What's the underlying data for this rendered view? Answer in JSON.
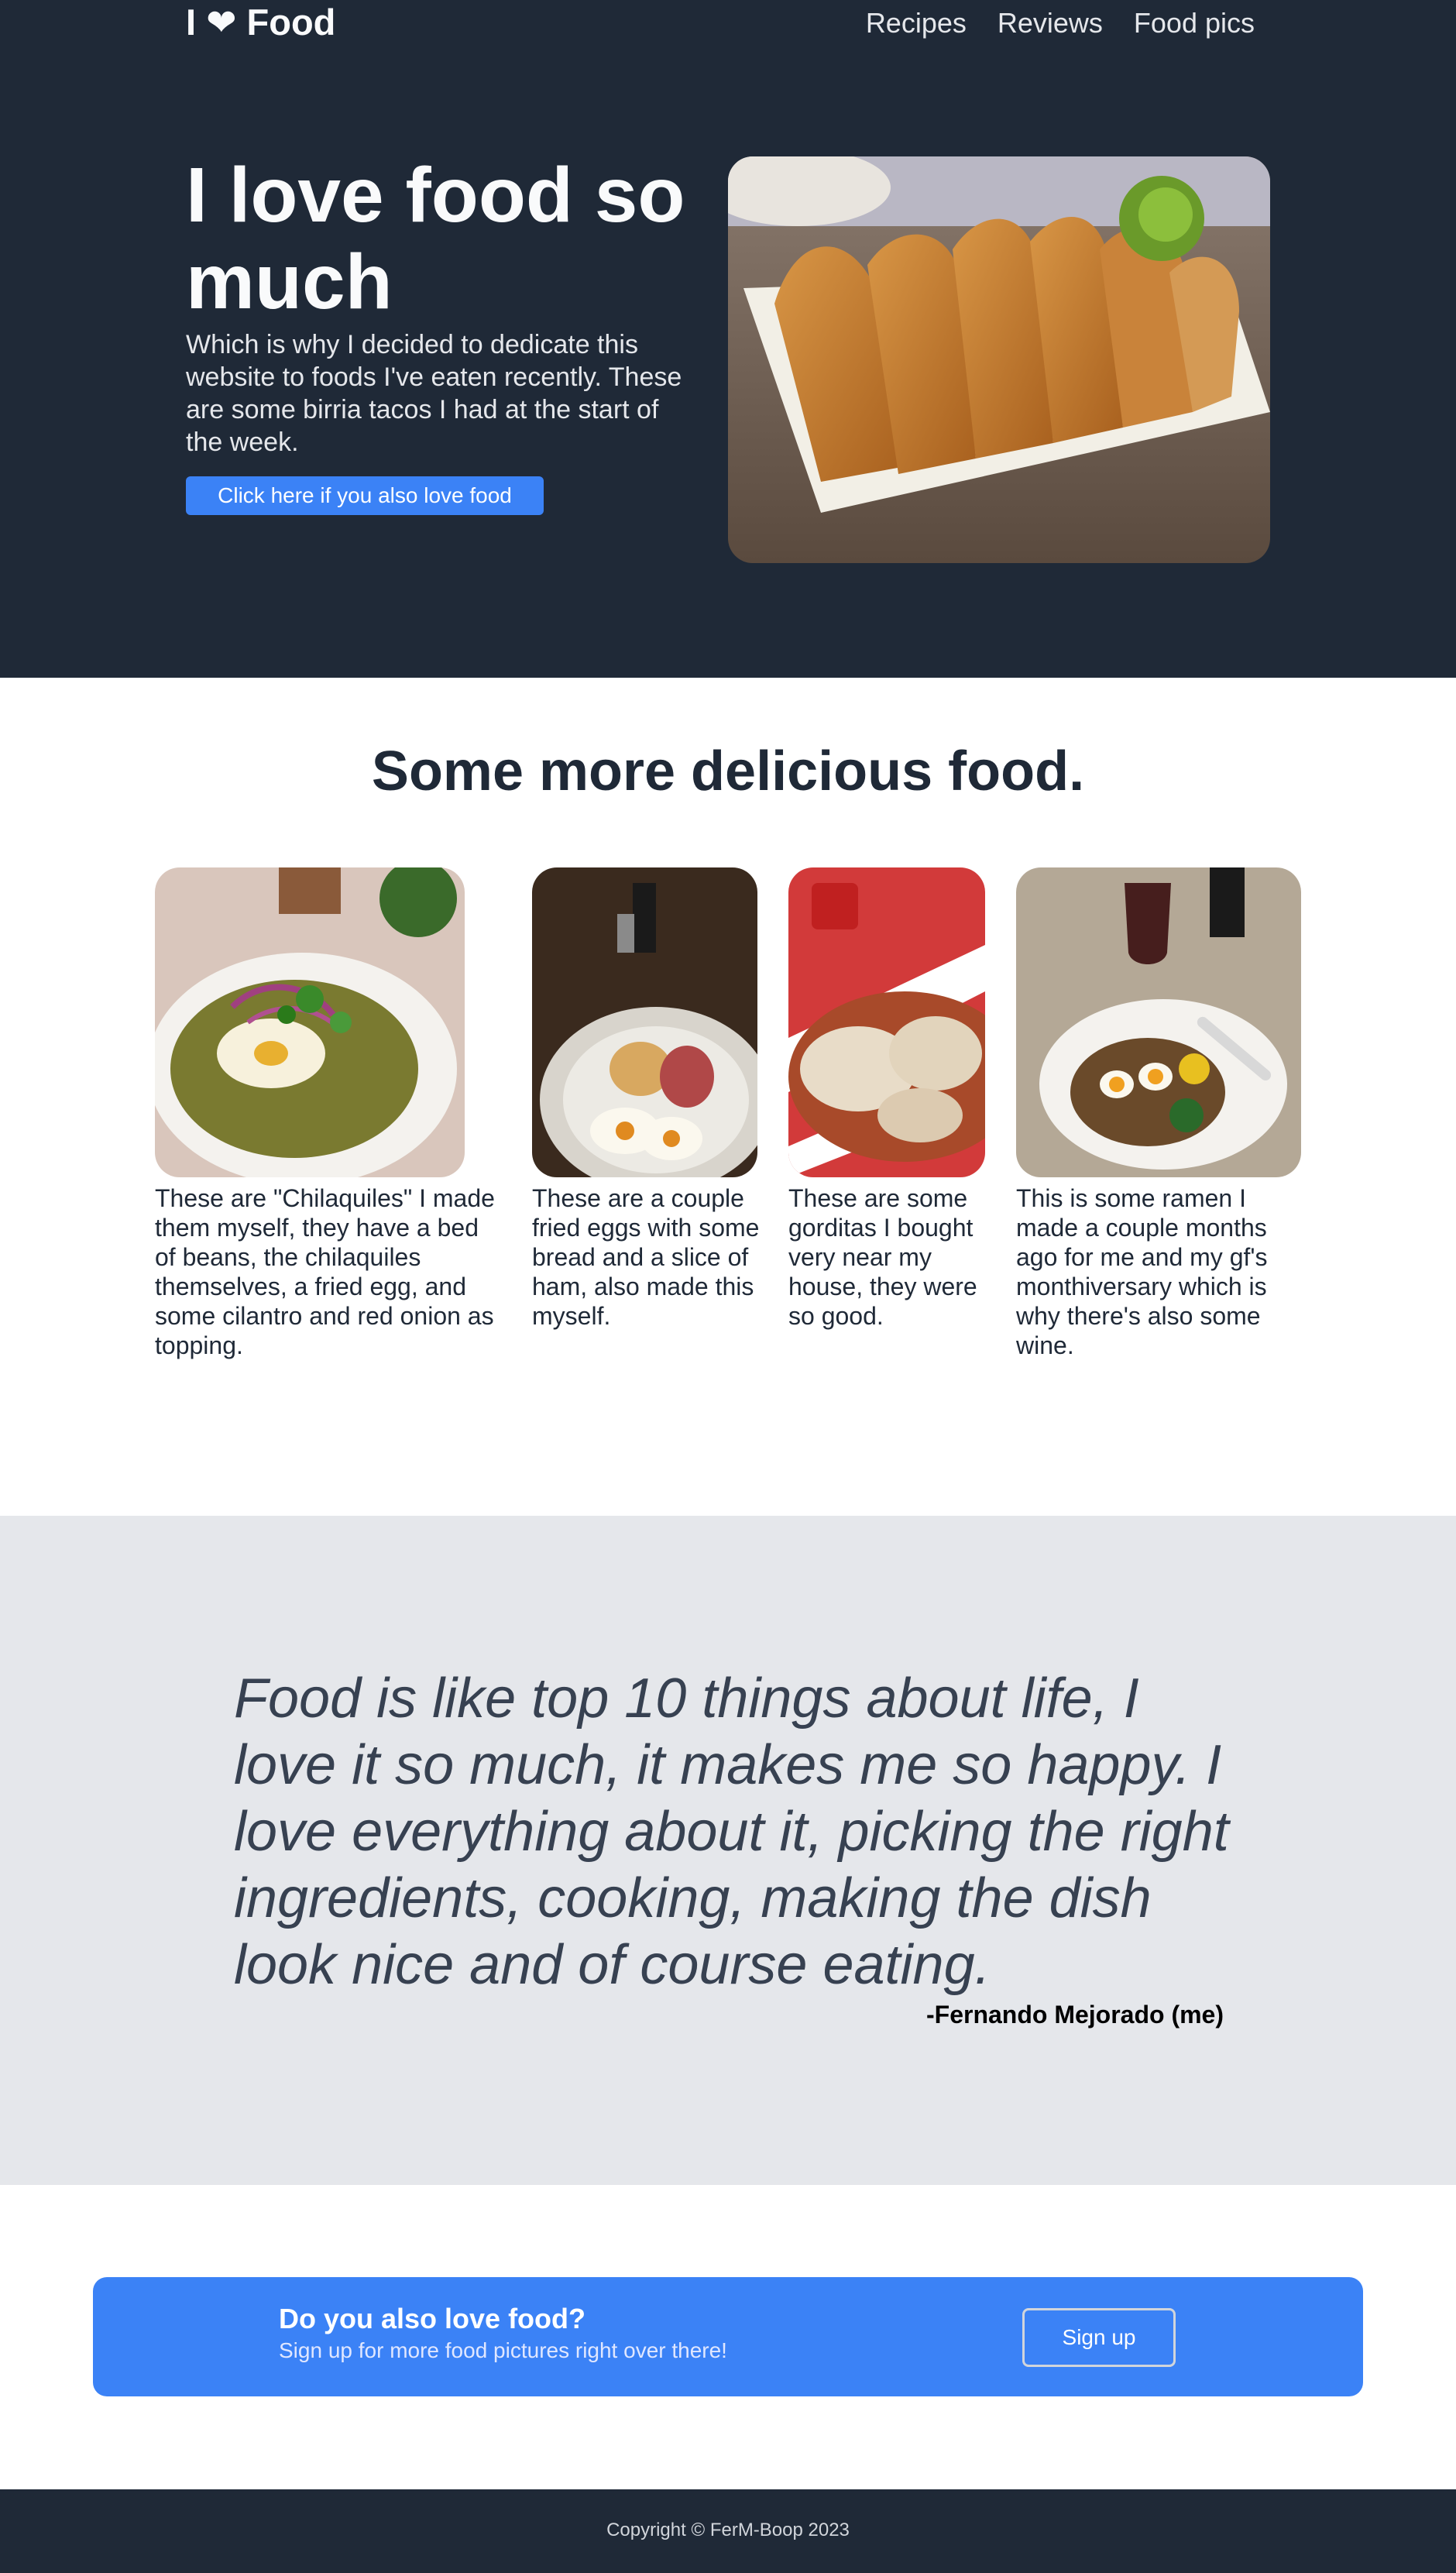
{
  "header": {
    "logo": "I ❤ Food",
    "nav": [
      "Recipes",
      "Reviews",
      "Food pics"
    ]
  },
  "hero": {
    "title": "I love food so much",
    "text": "Which is why I decided to dedicate this website to foods I've eaten recently. These are some birria tacos I had at the start of the week.",
    "button": "Click here if you also love food",
    "image_icon": "birria-tacos-photo"
  },
  "gallery": {
    "title": "Some more delicious food.",
    "cards": [
      {
        "text": "These are \"Chilaquiles\" I made them myself, they have a bed of beans, the chilaquiles themselves, a fried egg, and some cilantro and red onion as topping.",
        "image_icon": "chilaquiles-photo"
      },
      {
        "text": "These are a couple fried eggs with some bread and a slice of ham, also made this myself.",
        "image_icon": "fried-eggs-photo"
      },
      {
        "text": "These are some gorditas I bought very near my house, they were so good.",
        "image_icon": "gorditas-photo"
      },
      {
        "text": "This is some ramen I made a couple months ago for me and my gf's monthiversary which is why there's also some wine.",
        "image_icon": "ramen-photo"
      }
    ]
  },
  "quote": {
    "text": "Food is like top 10 things about life, I love it so much, it makes me so happy. I love everything about it, picking the right ingredients, cooking, making the dish look nice and of course eating.",
    "author": "-Fernando Mejorado (me)"
  },
  "cta": {
    "title": "Do you also love food?",
    "subtitle": "Sign up for more food pictures right over there!",
    "button": "Sign up"
  },
  "footer": {
    "text": "Copyright © FerM-Boop 2023"
  },
  "colors": {
    "dark": "#1f2937",
    "accent": "#3b82f6",
    "quote_bg": "#e5e7eb"
  }
}
